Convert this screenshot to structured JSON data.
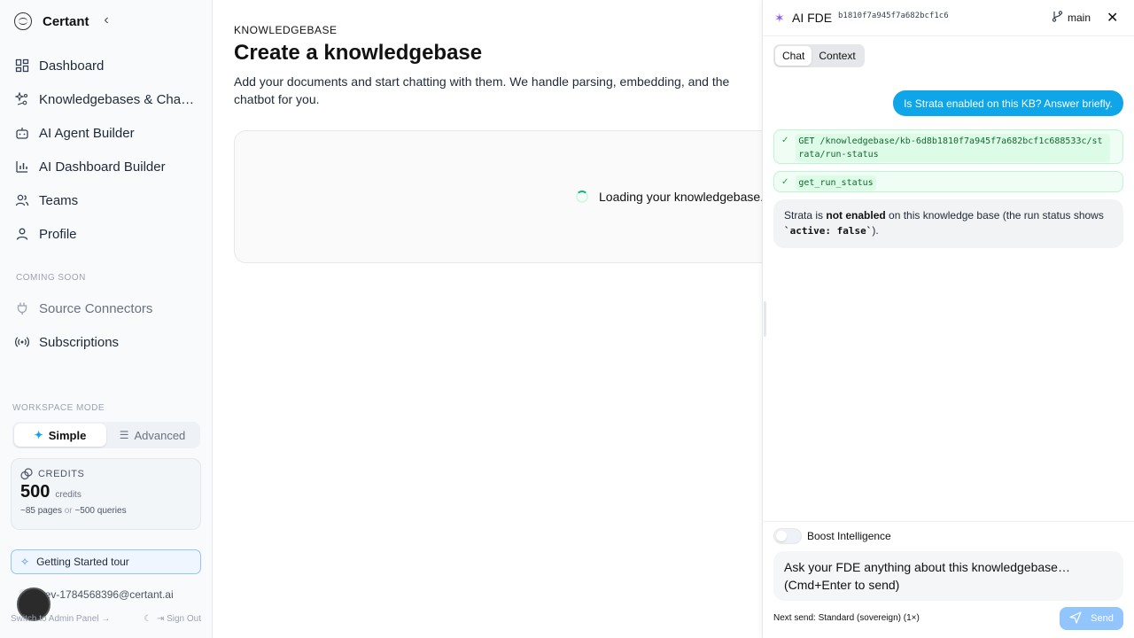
{
  "brand": {
    "name": "Certant"
  },
  "sidebar": {
    "items": [
      {
        "label": "Dashboard",
        "icon": "dashboard-icon"
      },
      {
        "label": "Knowledgebases & Chatb…",
        "icon": "sparkle-nodes-icon"
      },
      {
        "label": "AI Agent Builder",
        "icon": "bot-icon"
      },
      {
        "label": "AI Dashboard Builder",
        "icon": "bar-chart-icon"
      },
      {
        "label": "Teams",
        "icon": "users-icon"
      },
      {
        "label": "Profile",
        "icon": "user-icon"
      }
    ],
    "coming_soon_label": "COMING SOON",
    "coming_soon_items": [
      {
        "label": "Source Connectors",
        "icon": "plug-icon"
      },
      {
        "label": "Subscriptions",
        "icon": "broadcast-icon"
      }
    ],
    "workspace_mode_label": "WORKSPACE MODE",
    "modes": {
      "simple": "Simple",
      "advanced": "Advanced",
      "active": "Simple"
    },
    "credits": {
      "label": "CREDITS",
      "amount": "500",
      "unit": "credits",
      "pages": "~85 pages",
      "or": "or",
      "queries": "~500 queries"
    },
    "tour_label": "Getting Started tour",
    "user_email": "e-ev-1784568396@certant.ai",
    "admin_link": "Switch to Admin Panel →",
    "sign_out": "Sign Out"
  },
  "main": {
    "eyebrow": "KNOWLEDGEBASE",
    "title": "Create a knowledgebase",
    "description": "Add your documents and start chatting with them. We handle parsing, embedding, and the chatbot for you.",
    "loading_text": "Loading your knowledgebase."
  },
  "panel": {
    "title": "AI FDE",
    "session_id": "b1810f7a945f7a682bcf1c6",
    "branch": "main",
    "tabs": [
      "Chat",
      "Context"
    ],
    "active_tab": "Chat",
    "messages": {
      "user": "Is Strata enabled on this KB? Answer briefly.",
      "tool_call_1": "GET /knowledgebase/kb-6d8b1810f7a945f7a682bcf1c688533c/strata/run-status",
      "tool_call_2": "get_run_status",
      "bot_pre": "Strata is ",
      "bot_bold": "not enabled",
      "bot_mid": " on this knowledge base (the run status shows ",
      "bot_code": "`active: false`",
      "bot_post": ")."
    },
    "boost_label": "Boost Intelligence",
    "boost_on": false,
    "composer_placeholder": "Ask your FDE anything about this knowledgebase… (Cmd+Enter to send)",
    "next_send": "Next send: Standard (sovereign) (1×)",
    "send_label": "Send"
  },
  "colors": {
    "accent": "#0ea5e9",
    "tool_bg": "#f0fdf4",
    "spinner": "#10b981",
    "fde_icon": "#8b5cf6"
  }
}
